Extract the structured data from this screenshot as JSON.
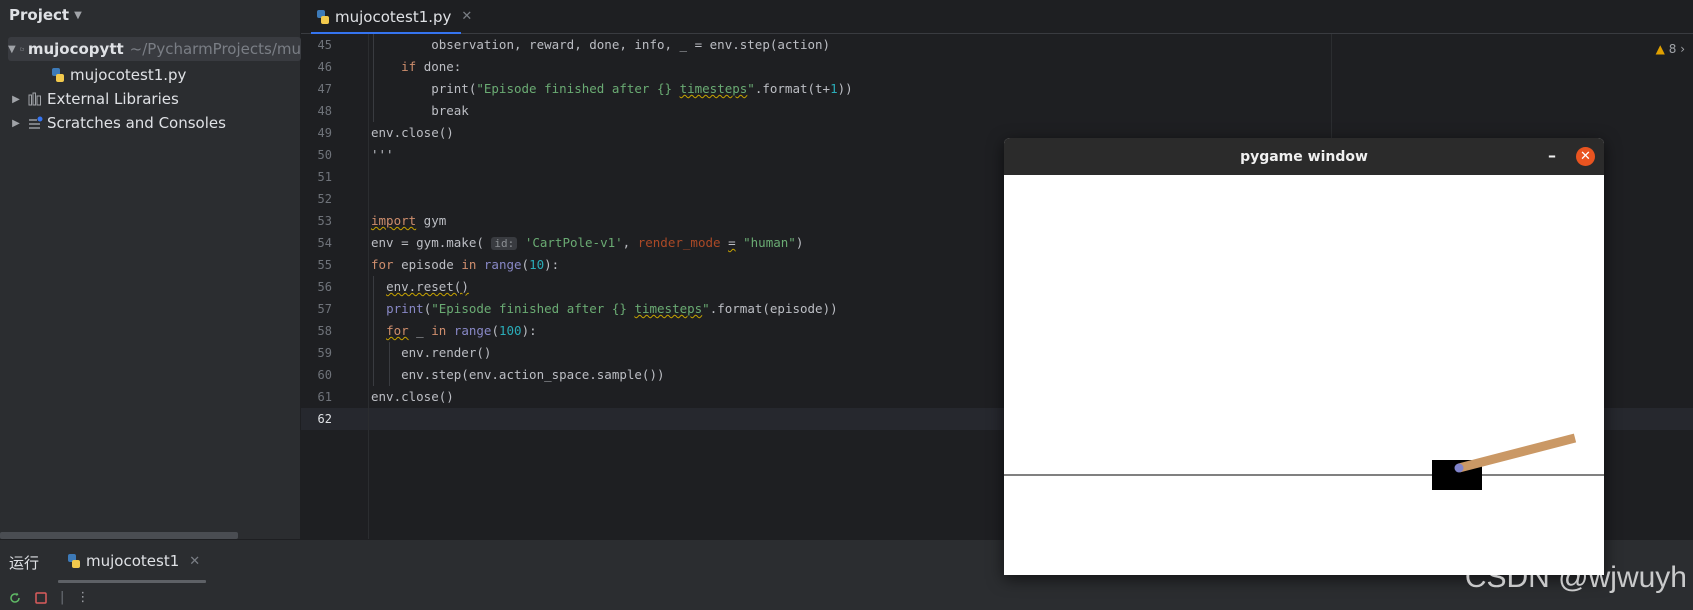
{
  "sidebar": {
    "title": "Project",
    "items": [
      {
        "label": "mujocopytt",
        "path": "~/PycharmProjects/mu"
      },
      {
        "label": "mujocotest1.py"
      },
      {
        "label": "External Libraries"
      },
      {
        "label": "Scratches and Consoles"
      }
    ]
  },
  "editor": {
    "tab_label": "mujocotest1.py",
    "warning_count": "8",
    "hint_label": "id:",
    "line_numbers": [
      "45",
      "46",
      "47",
      "48",
      "49",
      "50",
      "51",
      "52",
      "53",
      "54",
      "55",
      "56",
      "57",
      "58",
      "59",
      "60",
      "61",
      "62"
    ]
  },
  "bottom": {
    "run_label": "运行",
    "run_tab_label": "mujocotest1"
  },
  "pygame": {
    "title": "pygame window",
    "minimize": "–",
    "close": "✕"
  },
  "watermark": "CSDN @wjwuyh",
  "colors": {
    "accent": "#3574f0",
    "close_button": "#e95420",
    "pole": "#ca9865",
    "axle": "#8184cb"
  }
}
